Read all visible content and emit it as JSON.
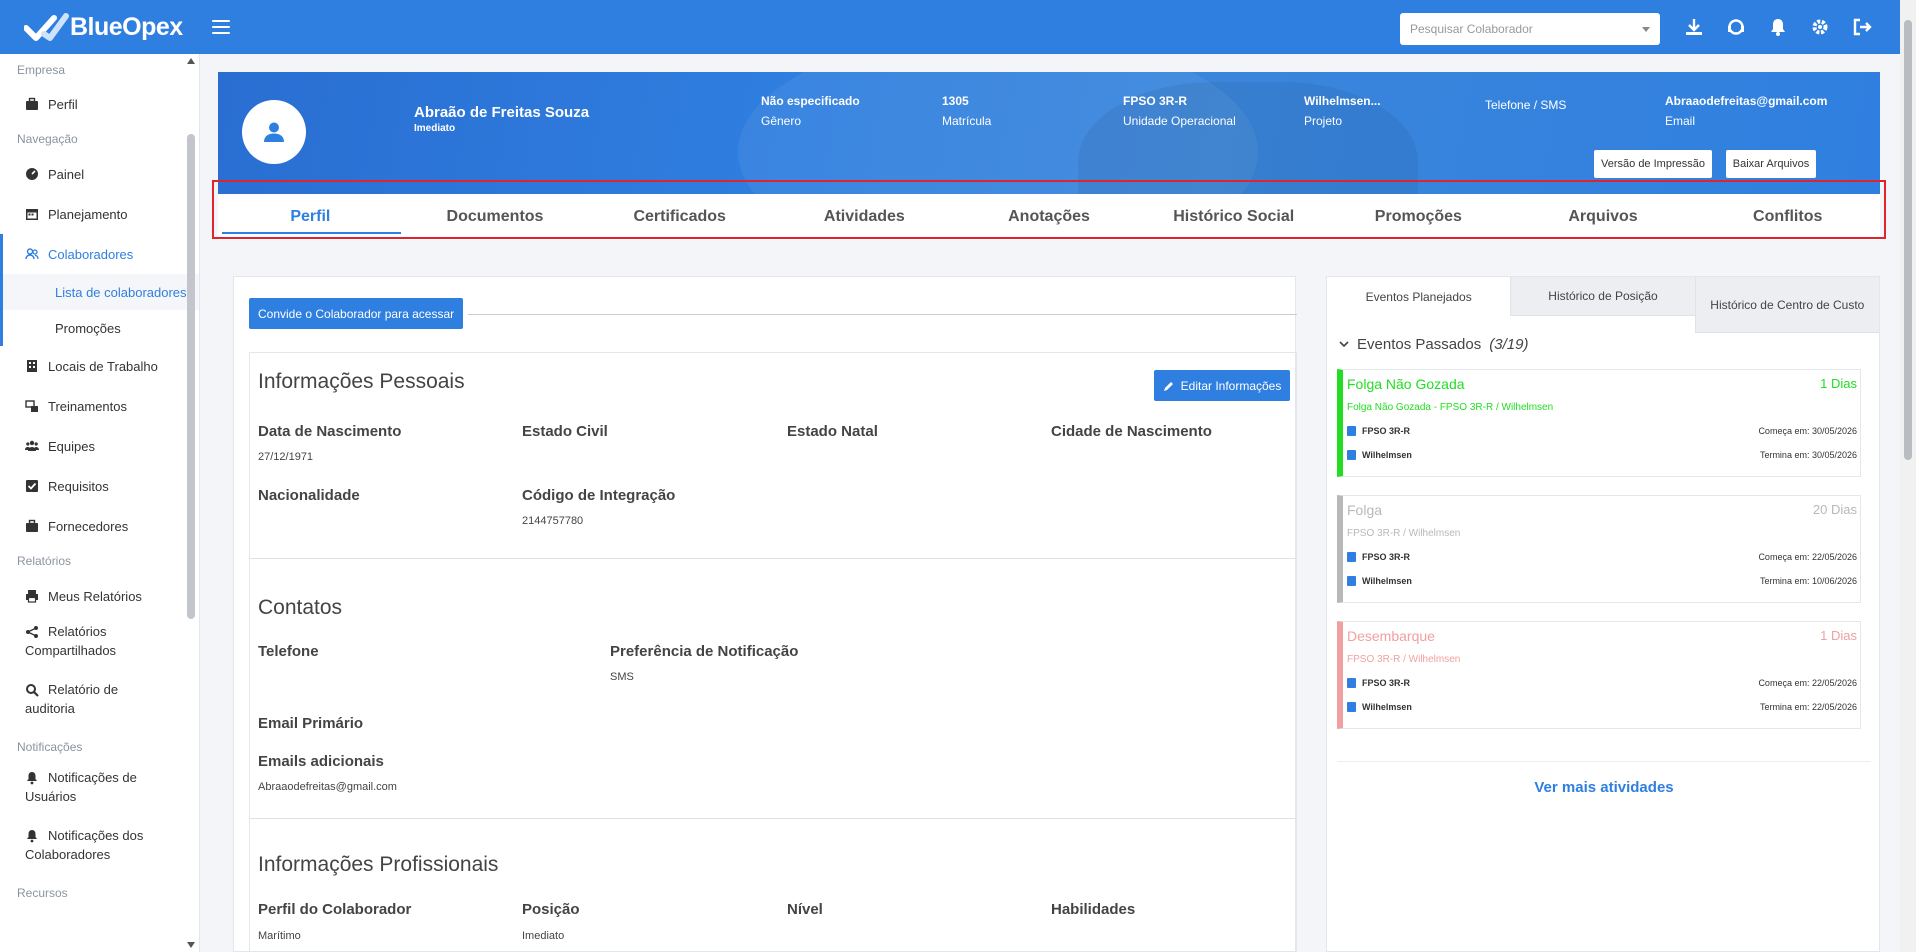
{
  "app": {
    "name": "BlueOpex"
  },
  "topbar": {
    "search_placeholder": "Pesquisar Colaborador"
  },
  "sidebar": {
    "sections": {
      "empresa": "Empresa",
      "navegacao": "Navegação",
      "relatorios": "Relatórios",
      "notificacoes": "Notificações",
      "recursos": "Recursos"
    },
    "items": {
      "perfil": "Perfil",
      "painel": "Painel",
      "planejamento": "Planejamento",
      "colaboradores": "Colaboradores",
      "lista": "Lista de colaboradores",
      "promocoes": "Promoções",
      "locais": "Locais de Trabalho",
      "treinamentos": "Treinamentos",
      "equipes": "Equipes",
      "requisitos": "Requisitos",
      "fornecedores": "Fornecedores",
      "meus_relatorios": "Meus Relatórios",
      "rel_compart_1": "Relatórios",
      "rel_compart_2": "Compartilhados",
      "rel_auditoria_1": "Relatório de",
      "rel_auditoria_2": "auditoria",
      "notif_usuarios_1": "Notificações de",
      "notif_usuarios_2": "Usuários",
      "notif_colab_1": "Notificações dos",
      "notif_colab_2": "Colaboradores"
    }
  },
  "profile": {
    "name": "Abraão de Freitas Souza",
    "role": "Imediato",
    "gender_value": "Não especificado",
    "gender_label": "Gênero",
    "matricula_value": "1305",
    "matricula_label": "Matrícula",
    "unidade_value": "FPSO 3R-R",
    "unidade_label": "Unidade Operacional",
    "projeto_value": "Wilhelmsen...",
    "projeto_label": "Projeto",
    "telefone_label": "Telefone / SMS",
    "email_value": "Abraaodefreitas@gmail.com",
    "email_label": "Email",
    "print_button": "Versão de Impressão",
    "download_button": "Baixar Arquivos"
  },
  "tabs": [
    "Perfil",
    "Documentos",
    "Certificados",
    "Atividades",
    "Anotações",
    "Histórico Social",
    "Promoções",
    "Arquivos",
    "Conflitos"
  ],
  "main": {
    "invite_button": "Convide o Colaborador para acessar",
    "personal": {
      "title": "Informações Pessoais",
      "edit_button": "Editar Informações",
      "birth_label": "Data de Nascimento",
      "birth_value": "27/12/1971",
      "civil_label": "Estado Civil",
      "natal_label": "Estado Natal",
      "city_label": "Cidade de Nascimento",
      "nationality_label": "Nacionalidade",
      "integration_label": "Código de Integração",
      "integration_value": "2144757780"
    },
    "contacts": {
      "title": "Contatos",
      "phone_label": "Telefone",
      "notif_label": "Preferência de Notificação",
      "notif_value": "SMS",
      "email_label": "Email Primário",
      "extra_emails_label": "Emails adicionais",
      "extra_emails_value": "Abraaodefreitas@gmail.com"
    },
    "professional": {
      "title": "Informações Profissionais",
      "profile_label": "Perfil do Colaborador",
      "profile_value": "Marítimo",
      "position_label": "Posição",
      "position_value": "Imediato",
      "level_label": "Nível",
      "skills_label": "Habilidades"
    }
  },
  "right_panel": {
    "tabs": [
      "Eventos Planejados",
      "Histórico de Posição",
      "Histórico de Centro de Custo"
    ],
    "past_events_label": "Eventos Passados",
    "past_events_count": "(3/19)",
    "events": [
      {
        "title": "Folga Não Gozada",
        "days": "1 Dias",
        "subtitle": "Folga Não Gozada - FPSO 3R-R / Wilhelmsen",
        "unit": "FPSO 3R-R",
        "project": "Wilhelmsen",
        "start": "Começa em: 30/05/2026",
        "end": "Termina em: 30/05/2026",
        "color": "#22dd22"
      },
      {
        "title": "Folga",
        "days": "20 Dias",
        "subtitle": "FPSO 3R-R / Wilhelmsen",
        "unit": "FPSO 3R-R",
        "project": "Wilhelmsen",
        "start": "Começa em: 22/05/2026",
        "end": "Termina em: 10/06/2026",
        "color": "#b8b8b8"
      },
      {
        "title": "Desembarque",
        "days": "1 Dias",
        "subtitle": "FPSO 3R-R / Wilhelmsen",
        "unit": "FPSO 3R-R",
        "project": "Wilhelmsen",
        "start": "Começa em: 22/05/2026",
        "end": "Termina em: 22/05/2026",
        "color": "#f0a0a0"
      }
    ],
    "more_link": "Ver mais atividades"
  },
  "colors": {
    "primary": "#2f7fe0",
    "highlight_outline": "#e0232c"
  }
}
